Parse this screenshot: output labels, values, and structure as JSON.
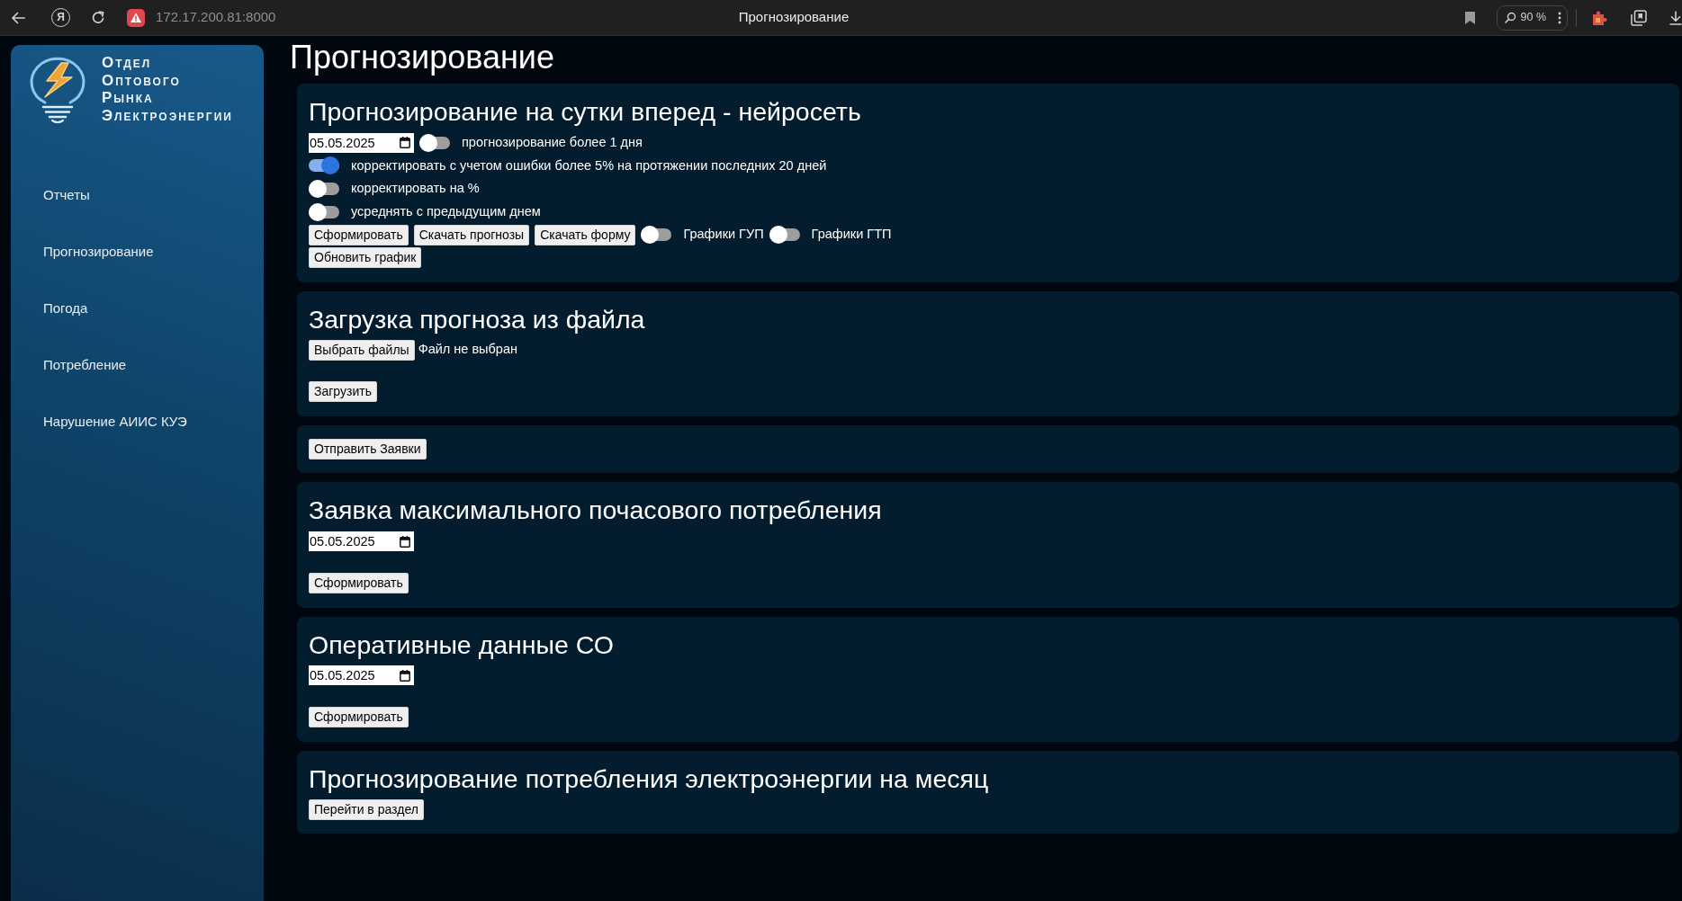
{
  "browser": {
    "logo_glyph": "Я",
    "address": "172.17.200.81:8000",
    "title": "Прогнозирование",
    "zoom": "90 %"
  },
  "sidebar": {
    "logo_lines": [
      "Отдел",
      "Оптового",
      "Рынка",
      "Электроэнергии"
    ],
    "items": [
      {
        "label": "Отчеты"
      },
      {
        "label": "Прогнозирование"
      },
      {
        "label": "Погода"
      },
      {
        "label": "Потребление"
      },
      {
        "label": "Нарушение АИИС КУЭ"
      }
    ]
  },
  "page_title": "Прогнозирование",
  "sections": [
    {
      "title": "Прогнозирование на сутки вперед - нейросеть",
      "groups": [
        {
          "rows": [
            [
              {
                "kind": "date",
                "value": "05.05.2025"
              },
              {
                "kind": "switch",
                "on": false,
                "label": "прогнозирование более 1 дня"
              }
            ],
            [
              {
                "kind": "switch",
                "on": true,
                "label": "корректировать с учетом ошибки более 5% на протяжении последних 20 дней"
              }
            ],
            [
              {
                "kind": "switch",
                "on": false,
                "label": "корректировать на %"
              }
            ],
            [
              {
                "kind": "switch",
                "on": false,
                "label": "усреднять с предыдущим днем"
              }
            ],
            [
              {
                "kind": "button",
                "label": "Сформировать"
              },
              {
                "kind": "button",
                "label": "Скачать прогнозы"
              },
              {
                "kind": "button",
                "label": "Скачать форму"
              },
              {
                "kind": "switch",
                "on": false,
                "label": "Графики ГУП"
              },
              {
                "kind": "switch",
                "on": false,
                "label": "Графики ГТП"
              }
            ],
            [
              {
                "kind": "button",
                "label": "Обновить график"
              }
            ]
          ]
        }
      ]
    },
    {
      "title": "Загрузка прогноза из файла",
      "groups": [
        {
          "rows": [
            [
              {
                "kind": "file",
                "button": "Выбрать файлы",
                "status": "Файл не выбран"
              }
            ]
          ]
        },
        {
          "rows": [
            [
              {
                "kind": "button",
                "label": "Загрузить"
              }
            ]
          ]
        }
      ]
    },
    {
      "groups": [
        {
          "rows": [
            [
              {
                "kind": "button",
                "label": "Отправить Заявки"
              }
            ]
          ]
        }
      ]
    },
    {
      "title": "Заявка максимального почасового потребления",
      "groups": [
        {
          "rows": [
            [
              {
                "kind": "date",
                "value": "05.05.2025"
              }
            ]
          ]
        },
        {
          "rows": [
            [
              {
                "kind": "button",
                "label": "Сформировать"
              }
            ]
          ]
        }
      ]
    },
    {
      "title": "Оперативные данные СО",
      "groups": [
        {
          "rows": [
            [
              {
                "kind": "date",
                "value": "05.05.2025"
              }
            ]
          ]
        },
        {
          "rows": [
            [
              {
                "kind": "button",
                "label": "Сформировать"
              }
            ]
          ]
        }
      ]
    },
    {
      "title": "Прогнозирование потребления электроэнергии на месяц",
      "groups": [
        {
          "rows": [
            [
              {
                "kind": "button",
                "label": "Перейти в раздел"
              }
            ]
          ]
        }
      ]
    }
  ]
}
